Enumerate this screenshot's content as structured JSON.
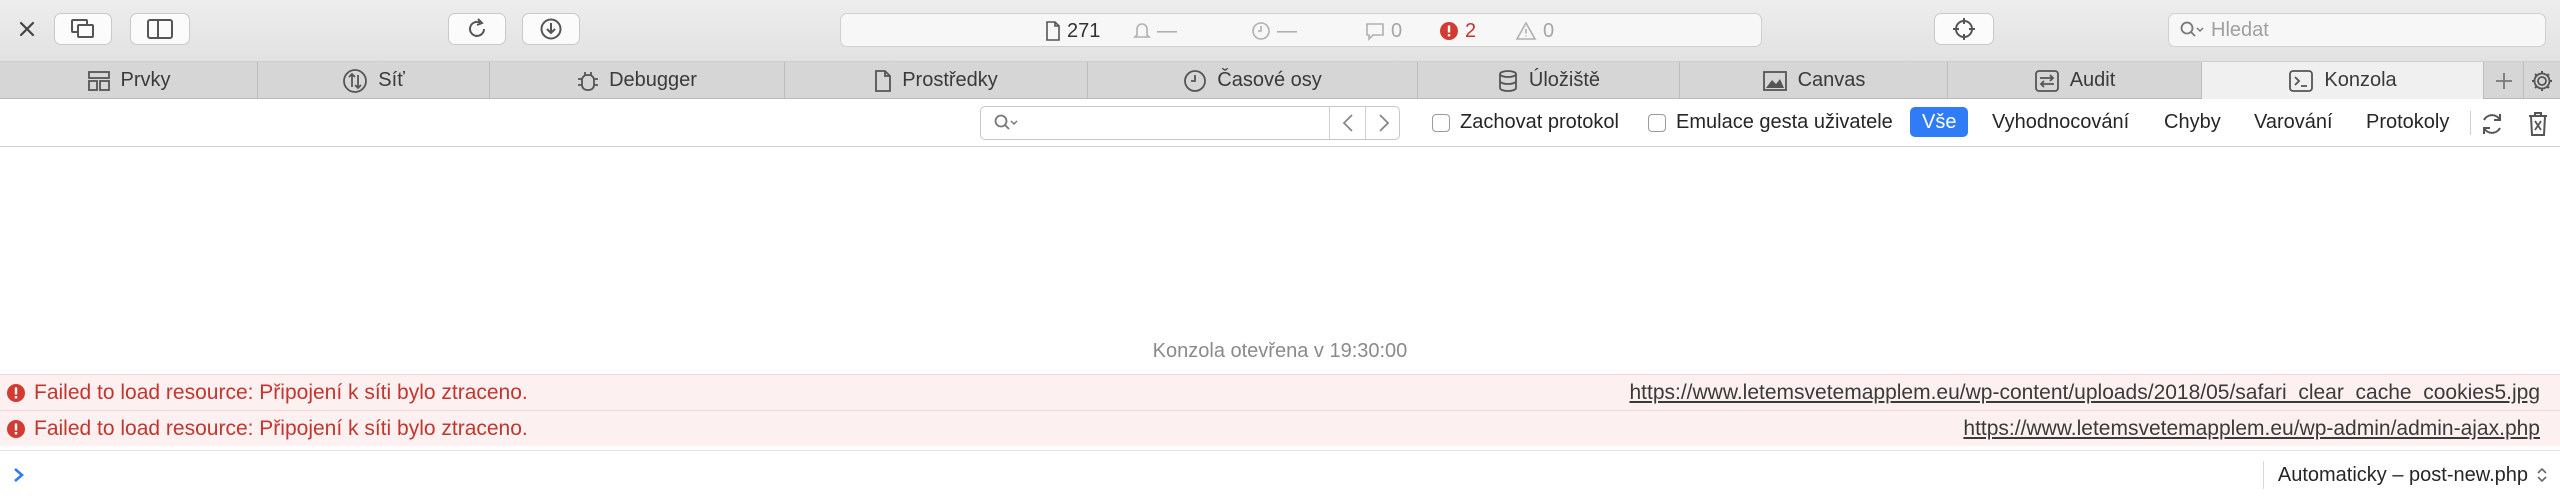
{
  "toolbar": {
    "icons": [
      "close-icon",
      "detach-window-icon",
      "dock-side-icon",
      "reload-icon",
      "download-icon",
      "inspect-icon"
    ],
    "stats": {
      "resources": "271",
      "notifications": "—",
      "time": "—",
      "logs": "0",
      "errors": "2",
      "warnings": "0"
    },
    "search_placeholder": "Hledat"
  },
  "tabs": [
    {
      "label": "Prvky",
      "icon": "elements-icon"
    },
    {
      "label": "Síť",
      "icon": "network-icon"
    },
    {
      "label": "Debugger",
      "icon": "debugger-icon"
    },
    {
      "label": "Prostředky",
      "icon": "resources-icon"
    },
    {
      "label": "Časové osy",
      "icon": "timelines-icon"
    },
    {
      "label": "Úložiště",
      "icon": "storage-icon"
    },
    {
      "label": "Canvas",
      "icon": "canvas-icon"
    },
    {
      "label": "Audit",
      "icon": "audit-icon"
    },
    {
      "label": "Konzola",
      "icon": "console-icon",
      "active": true
    }
  ],
  "filter": {
    "preserve_log": "Zachovat protokol",
    "emulate_gesture": "Emulace gesta uživatele",
    "levels": [
      "Vše",
      "Vyhodnocování",
      "Chyby",
      "Varování",
      "Protokoly"
    ],
    "active_level": "Vše"
  },
  "console": {
    "opened_message": "Konzola otevřena v 19:30:00",
    "messages": [
      {
        "level": "error",
        "text": "Failed to load resource: Připojení k síti bylo ztraceno.",
        "url": "https://www.letemsvetemapplem.eu/wp-content/uploads/2018/05/safari_clear_cache_cookies5.jpg"
      },
      {
        "level": "error",
        "text": "Failed to load resource: Připojení k síti bylo ztraceno.",
        "url": "https://www.letemsvetemapplem.eu/wp-admin/admin-ajax.php"
      }
    ],
    "execution_context": "Automaticky – post-new.php"
  },
  "colors": {
    "accent": "#2f7cf6",
    "error": "#c2362e",
    "error_row_bg": "#fdf0f0"
  }
}
